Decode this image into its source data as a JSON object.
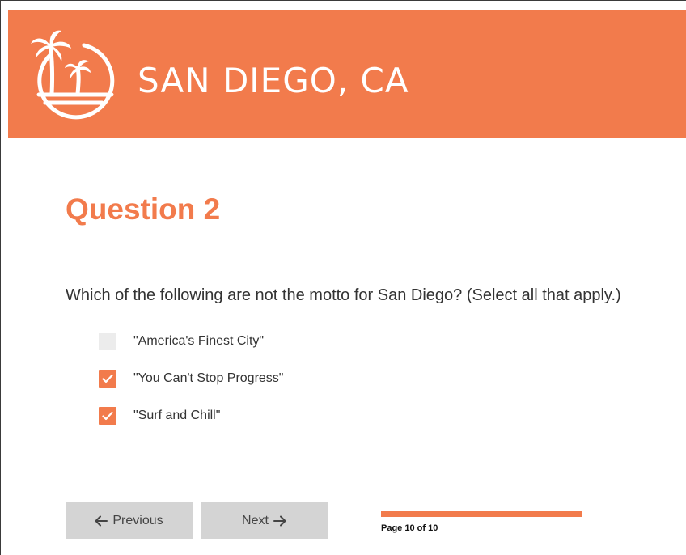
{
  "header": {
    "title": "SAN DIEGO, CA",
    "logo_icon": "palm-trees-sun-icon",
    "background_color": "#f27b4c"
  },
  "question": {
    "title": "Question 2",
    "prompt": "Which of the following are not the motto for San Diego? (Select all that apply.)",
    "options": [
      {
        "label": "\"America's Finest City\"",
        "checked": false
      },
      {
        "label": "\"You Can't Stop Progress\"",
        "checked": true
      },
      {
        "label": "\"Surf and Chill\"",
        "checked": true
      }
    ]
  },
  "navigation": {
    "previous_label": "Previous",
    "previous_icon": "arrow-left-icon",
    "next_label": "Next",
    "next_icon": "arrow-right-icon"
  },
  "progress": {
    "text": "Page 10 of 10",
    "fraction": 1.0
  },
  "colors": {
    "accent": "#f27b4c",
    "button_bg": "#d4d4d4",
    "unchecked_box": "#ececec"
  }
}
